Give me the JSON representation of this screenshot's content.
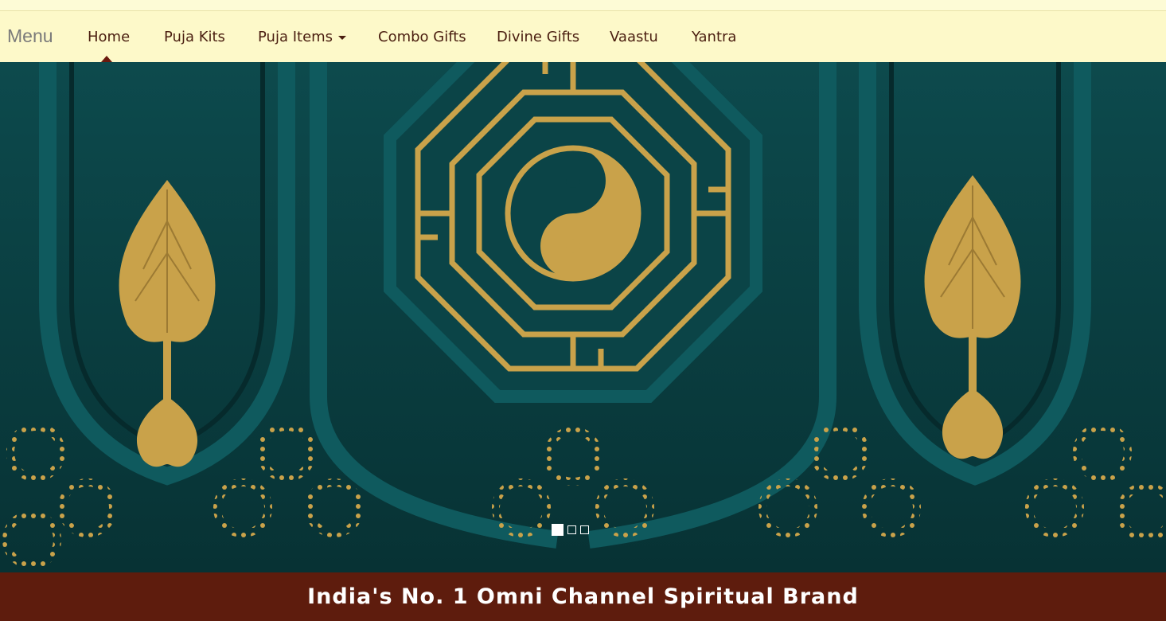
{
  "nav": {
    "menu_label": "Menu",
    "items": [
      {
        "label": "Home",
        "active": true
      },
      {
        "label": "Puja Kits"
      },
      {
        "label": "Puja Items",
        "has_dropdown": true
      },
      {
        "label": "Combo Gifts"
      },
      {
        "label": "Divine Gifts"
      },
      {
        "label": "Vaastu"
      },
      {
        "label": "Yantra"
      }
    ]
  },
  "carousel": {
    "slide_count": 3,
    "active_slide": 1,
    "image": "teal-and-gold-bagua-yin-yang-gate"
  },
  "banner": {
    "text": "India's No. 1 Omni Channel Spiritual Brand"
  },
  "colors": {
    "nav_bg": "#fdf9c9",
    "nav_text": "#4a1e10",
    "banner_bg": "#5e1c0d",
    "teal": "#0a3b3e",
    "gold": "#c9a24a"
  }
}
